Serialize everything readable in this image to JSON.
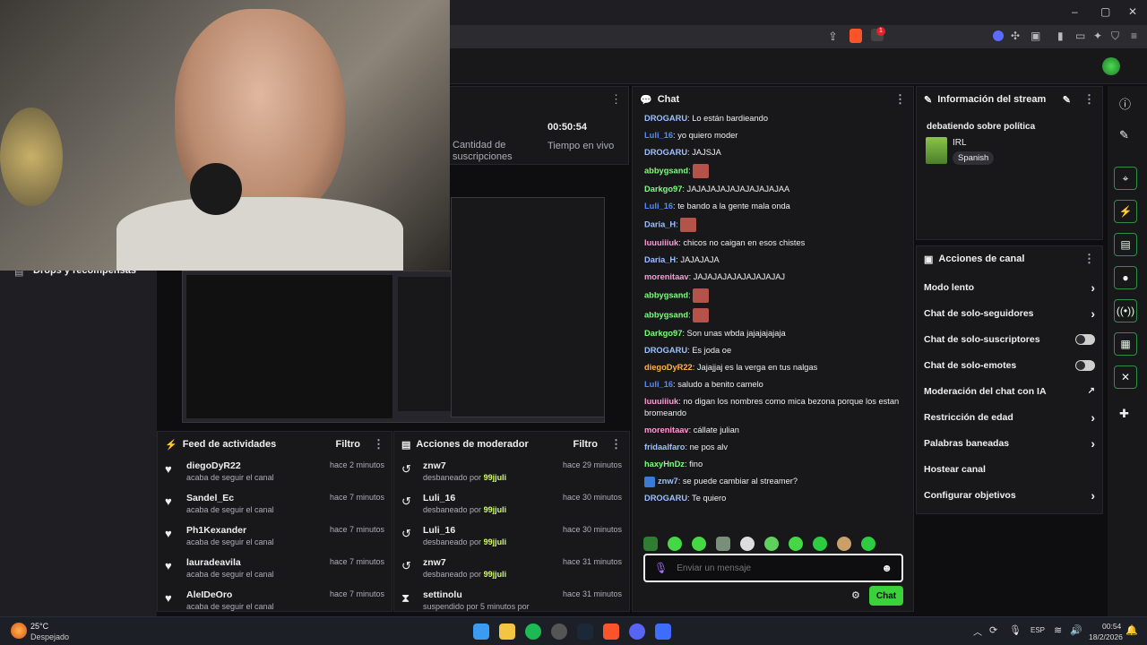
{
  "browser": {
    "window_controls": {
      "minimize": "–",
      "maximize": "▢",
      "close": "✕"
    },
    "brave_badge": "1"
  },
  "stream_stats": {
    "subs_label": "Cantidad de suscripciones",
    "uptime_value": "00:50:54",
    "uptime_label": "Tiempo en vivo"
  },
  "left_sidebar": {
    "drops_label": "Drops y recompensas"
  },
  "activity_feed": {
    "title": "Feed de actividades",
    "filter_label": "Filtro",
    "items": [
      {
        "name": "diegoDyR22",
        "action": "acaba de seguir el canal",
        "time": "hace 2 minutos"
      },
      {
        "name": "Sandel_Ec",
        "action": "acaba de seguir el canal",
        "time": "hace 7 minutos"
      },
      {
        "name": "Ph1Kexander",
        "action": "acaba de seguir el canal",
        "time": "hace 7 minutos"
      },
      {
        "name": "lauradeavila",
        "action": "acaba de seguir el canal",
        "time": "hace 7 minutos"
      },
      {
        "name": "AleIDeOro",
        "action": "acaba de seguir el canal",
        "time": "hace 7 minutos"
      }
    ]
  },
  "mod_actions": {
    "title": "Acciones de moderador",
    "filter_label": "Filtro",
    "items": [
      {
        "name": "znw7",
        "action": "desbaneado por",
        "by": "99jjuli",
        "time": "hace 29 minutos"
      },
      {
        "name": "Luli_16",
        "action": "desbaneado por",
        "by": "99jjuli",
        "time": "hace 30 minutos"
      },
      {
        "name": "Luli_16",
        "action": "desbaneado por",
        "by": "99jjuli",
        "time": "hace 30 minutos"
      },
      {
        "name": "znw7",
        "action": "desbaneado por",
        "by": "99jjuli",
        "time": "hace 31 minutos"
      },
      {
        "name": "settinolu",
        "action": "suspendido por 5 minutos por",
        "by": "99jjuli",
        "time": "hace 31 minutos"
      }
    ]
  },
  "chat": {
    "title": "Chat",
    "input_placeholder": "Enviar un mensaje",
    "send_label": "Chat",
    "messages": [
      {
        "user": "DROGARU",
        "color": "#9ec0ff",
        "text": "Lo están bardieando"
      },
      {
        "user": "Luli_16",
        "color": "#4f8cff",
        "text": "yo quiero moder"
      },
      {
        "user": "DROGARU",
        "color": "#9ec0ff",
        "text": "JAJSJA"
      },
      {
        "user": "abbygsand",
        "color": "#7cff7c",
        "text": "",
        "emote": true
      },
      {
        "user": "Darkgo97",
        "color": "#7cff7c",
        "text": "JAJAJAJAJAJAJAJAJAJAA"
      },
      {
        "user": "Luli_16",
        "color": "#4f8cff",
        "text": "te bando a la gente mala onda"
      },
      {
        "user": "Daria_H",
        "color": "#9ec0ff",
        "text": "",
        "emote": true
      },
      {
        "user": "luuuiiiuk",
        "color": "#ff9ad8",
        "text": "chicos no caigan en esos chistes"
      },
      {
        "user": "Daria_H",
        "color": "#9ec0ff",
        "text": "JAJAJAJA"
      },
      {
        "user": "morenitaav",
        "color": "#ff9ad8",
        "text": "JAJAJAJAJAJAJAJAJAJ"
      },
      {
        "user": "abbygsand",
        "color": "#7cff7c",
        "text": "",
        "emote": true
      },
      {
        "user": "abbygsand",
        "color": "#7cff7c",
        "text": "",
        "emote": true
      },
      {
        "user": "Darkgo97",
        "color": "#7cff7c",
        "text": "Son unas wbda jajajajajaja"
      },
      {
        "user": "DROGARU",
        "color": "#9ec0ff",
        "text": "Es joda oe"
      },
      {
        "user": "diegoDyR22",
        "color": "#ffb347",
        "text": "Jajajjaj es la verga en tus nalgas"
      },
      {
        "user": "Luli_16",
        "color": "#4f8cff",
        "text": "saludo a benito camelo"
      },
      {
        "user": "luuuiiiuk",
        "color": "#ff9ad8",
        "text": "no digan los nombres como mica bezona porque los estan bromeando"
      },
      {
        "user": "morenitaav",
        "color": "#ff9ad8",
        "text": "cállate julian"
      },
      {
        "user": "fridaalfaro",
        "color": "#9ec0ff",
        "text": "ne pos alv"
      },
      {
        "user": "haxyHnDz",
        "color": "#7cff7c",
        "text": "fino"
      },
      {
        "user": "znw7",
        "color": "#9ec0ff",
        "text": "se puede cambiar al streamer?",
        "badge": true
      },
      {
        "user": "DROGARU",
        "color": "#9ec0ff",
        "text": "Te quiero"
      }
    ]
  },
  "stream_info": {
    "title": "Información del stream",
    "stream_title": "debatiendo sobre política",
    "category": "IRL",
    "language": "Spanish"
  },
  "channel_actions": {
    "title": "Acciones de canal",
    "items": [
      {
        "label": "Modo lento",
        "kind": "chevron"
      },
      {
        "label": "Chat de solo-seguidores",
        "kind": "chevron"
      },
      {
        "label": "Chat de solo-suscriptores",
        "kind": "toggle"
      },
      {
        "label": "Chat de solo-emotes",
        "kind": "toggle"
      },
      {
        "label": "Moderación del chat con IA",
        "kind": "external"
      },
      {
        "label": "Restricción de edad",
        "kind": "chevron"
      },
      {
        "label": "Palabras baneadas",
        "kind": "chevron"
      },
      {
        "label": "Hostear canal",
        "kind": "none"
      },
      {
        "label": "Configurar objetivos",
        "kind": "chevron"
      }
    ]
  },
  "taskbar": {
    "weather_temp": "25°C",
    "weather_desc": "Despejado",
    "language": "ESP",
    "time": "00:54",
    "date": "18/2/2026"
  },
  "colors": {
    "accent": "#3ad13a",
    "highlight": "#d3ff66",
    "panel": "#18181b"
  }
}
